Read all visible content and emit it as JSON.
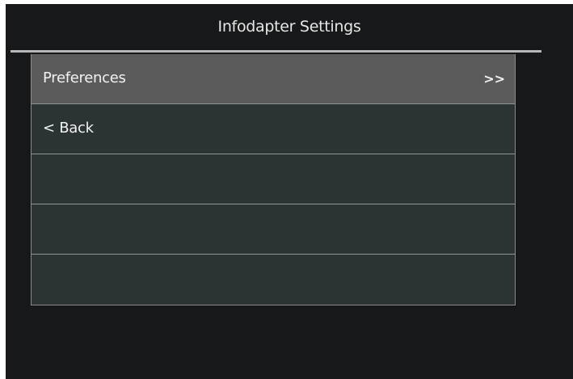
{
  "header": {
    "title": "Infodapter Settings"
  },
  "menu": {
    "items": [
      {
        "label": "Preferences",
        "arrow": ">>",
        "selected": true
      },
      {
        "label": "< Back",
        "arrow": "",
        "selected": false
      },
      {
        "label": "",
        "arrow": "",
        "selected": false
      },
      {
        "label": "",
        "arrow": "",
        "selected": false
      },
      {
        "label": "",
        "arrow": "",
        "selected": false
      }
    ]
  },
  "colors": {
    "background": "#171819",
    "menu_background": "#2b3433",
    "selected_row": "#5b5b5b",
    "text": "#f2f2f2"
  }
}
